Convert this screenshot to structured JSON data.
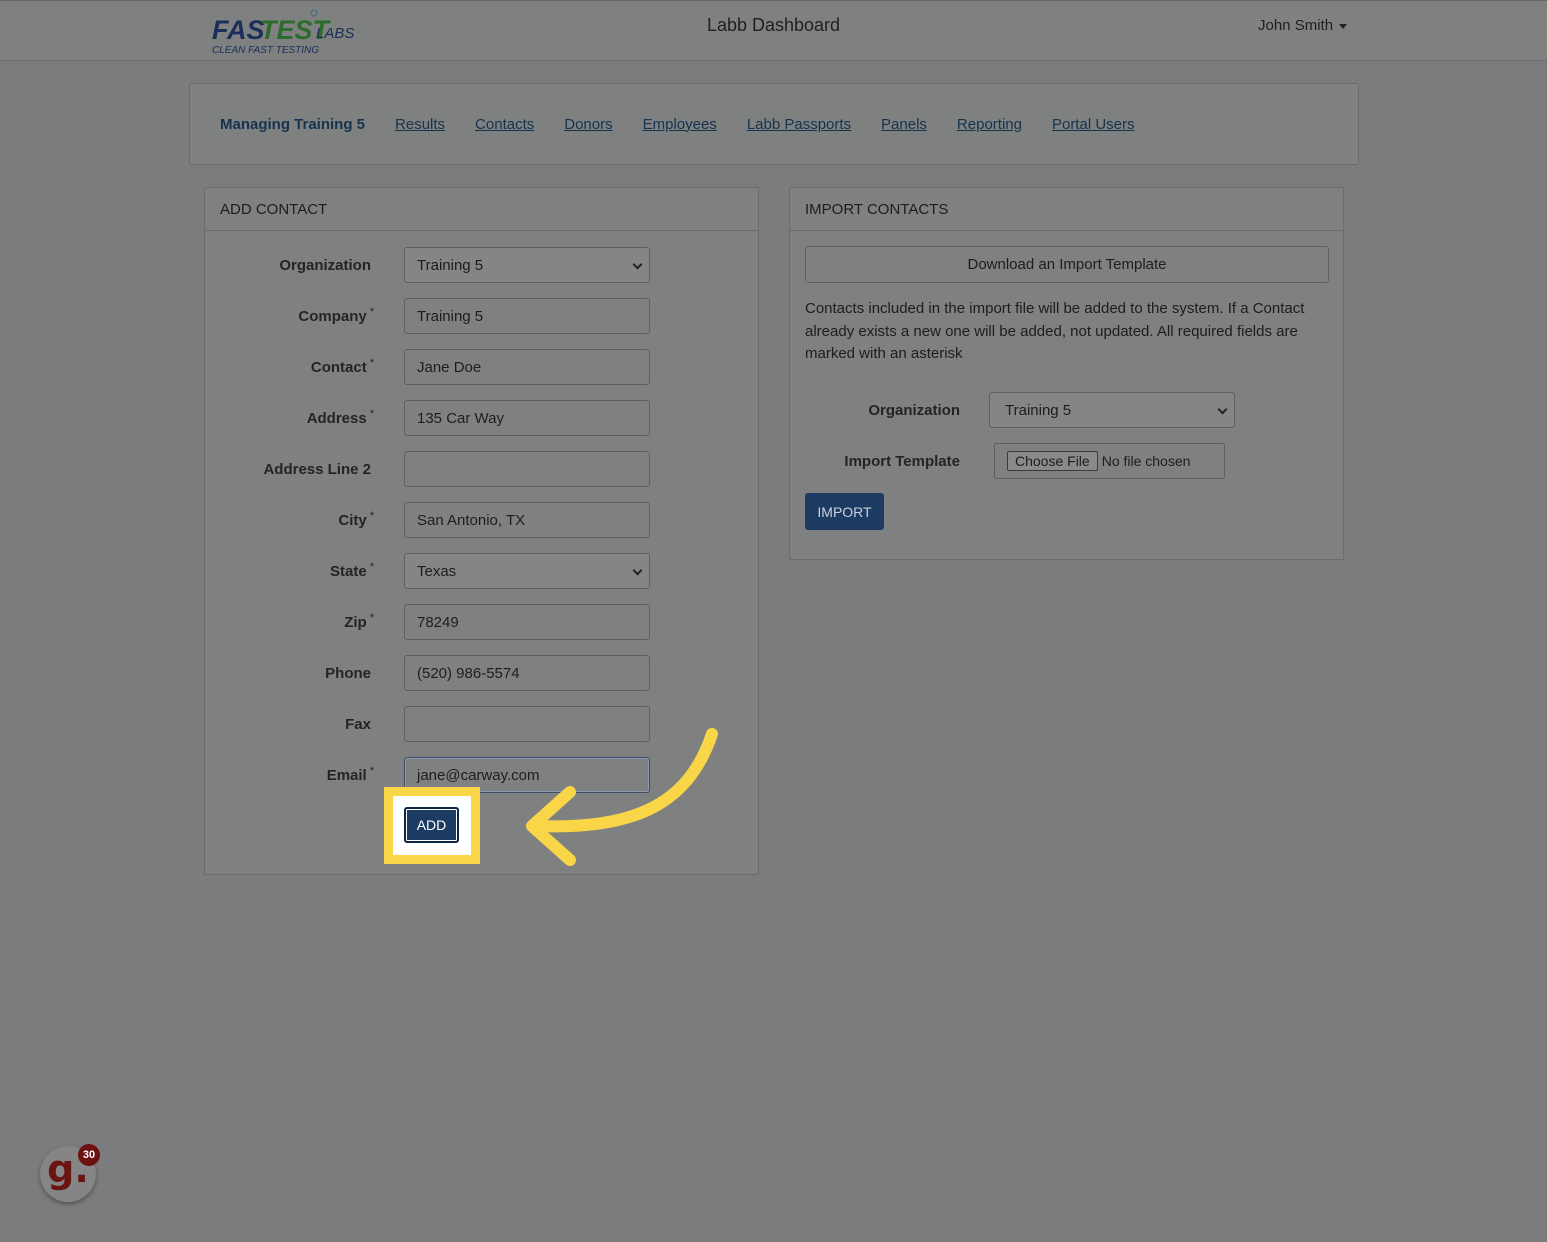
{
  "header": {
    "logo_text": "FASTEST LABS",
    "logo_tagline": "CLEAN FAST TESTING",
    "title": "Labb Dashboard",
    "user_name": "John Smith"
  },
  "nav": {
    "current": "Managing Training 5",
    "links": [
      "Results",
      "Contacts",
      "Donors",
      "Employees",
      "Labb Passports",
      "Panels",
      "Reporting",
      "Portal Users"
    ]
  },
  "add_contact": {
    "heading": "ADD CONTACT",
    "fields": [
      {
        "label": "Organization",
        "required": "",
        "value": "Training 5",
        "type": "select"
      },
      {
        "label": "Company",
        "required": "*",
        "value": "Training 5",
        "type": "text"
      },
      {
        "label": "Contact",
        "required": "*",
        "value": "Jane Doe",
        "type": "text"
      },
      {
        "label": "Address",
        "required": "*",
        "value": "135 Car Way",
        "type": "text"
      },
      {
        "label": "Address Line 2",
        "required": "",
        "value": "",
        "type": "text"
      },
      {
        "label": "City",
        "required": "*",
        "value": "San Antonio, TX",
        "type": "text"
      },
      {
        "label": "State",
        "required": "*",
        "value": "Texas",
        "type": "select"
      },
      {
        "label": "Zip",
        "required": "*",
        "value": "78249",
        "type": "text"
      },
      {
        "label": "Phone",
        "required": "",
        "value": "(520) 986-5574",
        "type": "text"
      },
      {
        "label": "Fax",
        "required": "",
        "value": "",
        "type": "text"
      },
      {
        "label": "Email",
        "required": "*",
        "value": "jane@carway.com",
        "type": "text"
      }
    ],
    "add_label": "ADD"
  },
  "import_contacts": {
    "heading": "IMPORT CONTACTS",
    "download_label": "Download an Import Template",
    "description": "Contacts included in the import file will be added to the system. If a Contact already exists a new one will be added, not updated. All required fields are marked with an asterisk",
    "organization_label": "Organization",
    "organization_value": "Training 5",
    "template_label": "Import Template",
    "choose_file_label": "Choose File",
    "no_file_label": "No file chosen",
    "import_label": "IMPORT"
  },
  "widget": {
    "letter": "g.",
    "badge_count": "30"
  },
  "colors": {
    "overlay_bg": "#7b7c7d",
    "primary_button": "#1c3b63",
    "highlight": "#f9d648",
    "badge": "#6d1010"
  }
}
